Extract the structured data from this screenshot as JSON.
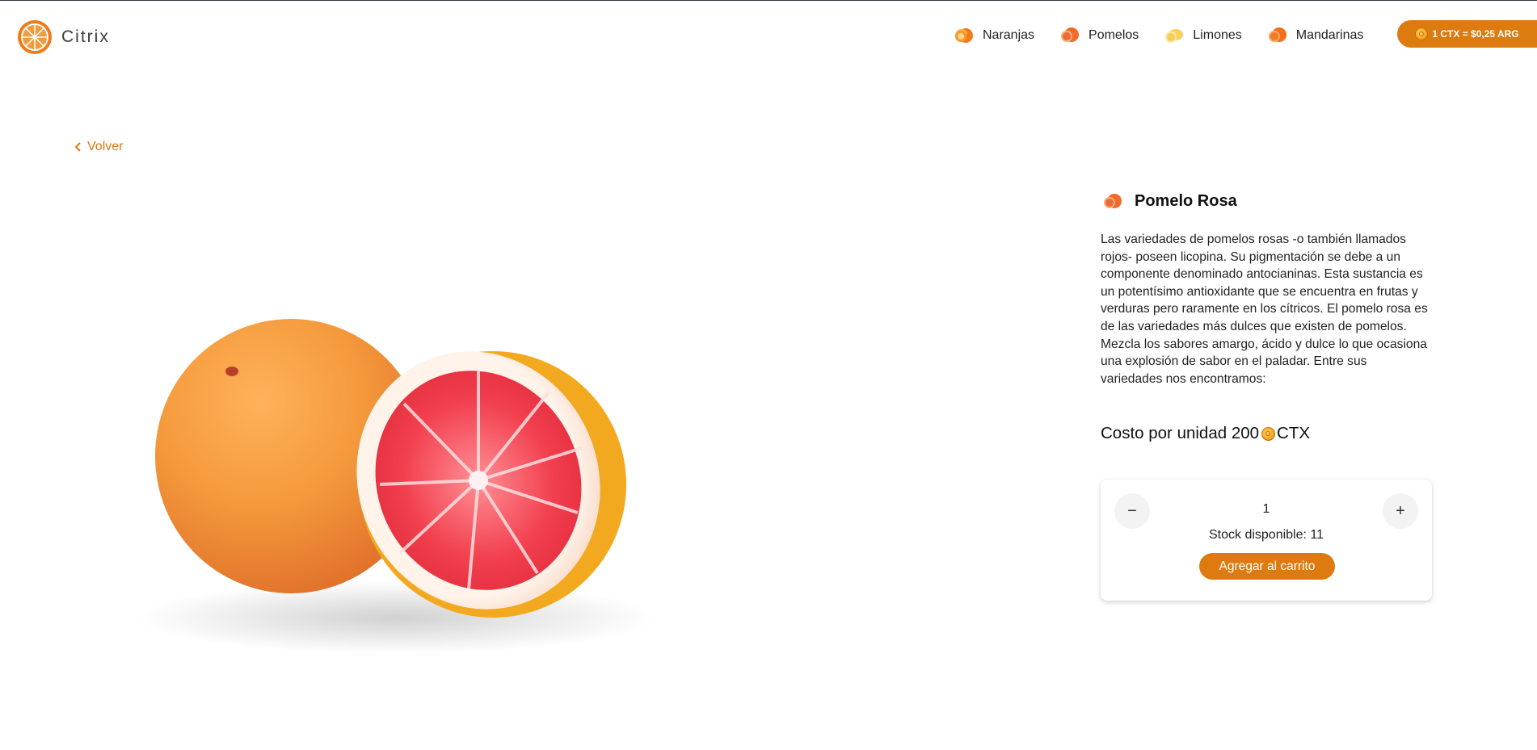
{
  "app": {
    "name": "Citrix"
  },
  "nav": {
    "items": [
      {
        "label": "Naranjas",
        "icon": "orange-icon",
        "color": "#f07a1a"
      },
      {
        "label": "Pomelos",
        "icon": "grapefruit-icon",
        "color": "#f2692c"
      },
      {
        "label": "Limones",
        "icon": "lemon-icon",
        "color": "#f4c64a"
      },
      {
        "label": "Mandarinas",
        "icon": "mandarin-icon",
        "color": "#f27220"
      }
    ]
  },
  "rate": {
    "label": "1 CTX = $0,25 ARG"
  },
  "back": {
    "label": "Volver"
  },
  "product": {
    "title": "Pomelo Rosa",
    "description": "Las variedades de pomelos rosas -o también llamados rojos- poseen licopina. Su pigmentación se debe a un componente denominado antocianinas. Esta sustancia es un potentísimo antioxidante que se encuentra en frutas y verduras pero raramente en los cítricos. El pomelo rosa es de las variedades más dulces que existen de pomelos. Mezcla los sabores amargo, ácido y dulce lo que ocasiona una explosión de sabor en el paladar. Entre sus variedades nos encontramos:",
    "price_prefix": "Costo por unidad 200",
    "price_currency": "CTX"
  },
  "cart": {
    "quantity": "1",
    "minus_label": "−",
    "plus_label": "+",
    "stock_label": "Stock disponible: 11",
    "add_label": "Agregar al carrito"
  },
  "colors": {
    "accent": "#dd7a10",
    "link": "#e07812"
  }
}
